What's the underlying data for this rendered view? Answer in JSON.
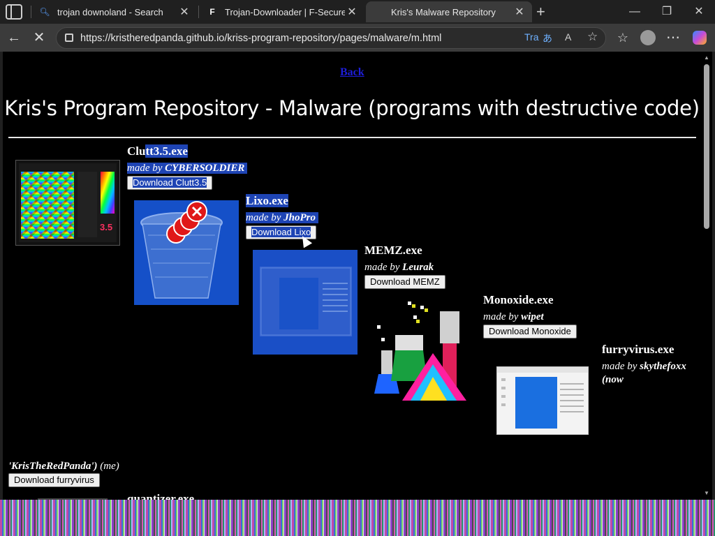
{
  "tabs": [
    {
      "title": "trojan downoland - Search",
      "icon": "search-icon"
    },
    {
      "title": "Trojan-Downloader | F-Secure",
      "icon": "fsecure-logo-icon"
    },
    {
      "title": "Kris's Malware Repository",
      "icon": "none",
      "active": true
    }
  ],
  "address": {
    "url": "https://kristheredpanda.github.io/kriss-program-repository/pages/malware/m.html",
    "translate_label": "Tra"
  },
  "page": {
    "back_link": "Back",
    "title": "Kris's Program Repository - Malware (programs with destructive code)",
    "made_by_prefix": "made by",
    "entries": [
      {
        "name": "Clutt3.5.exe",
        "author": "CYBERSOLDIER",
        "button": "Download Clutt3.5"
      },
      {
        "name": "Lixo.exe",
        "author": "JhoPro",
        "button": "Download Lixo"
      },
      {
        "name": "MEMZ.exe",
        "author": "Leurak",
        "button": "Download MEMZ"
      },
      {
        "name": "Monoxide.exe",
        "author": "wipet",
        "button": "Download Monoxide"
      },
      {
        "name": "furryvirus.exe",
        "author": "skythefoxx",
        "author_suffix": "(now",
        "author_cont_name": "'KrisTheRedPanda')",
        "author_cont_rest": "(me)",
        "button": "Download furryvirus"
      },
      {
        "name": "quantizer.exe"
      }
    ]
  },
  "colors": {
    "selection": "#1e44b4",
    "link": "#1d1dd9",
    "page_bg": "#000000"
  }
}
